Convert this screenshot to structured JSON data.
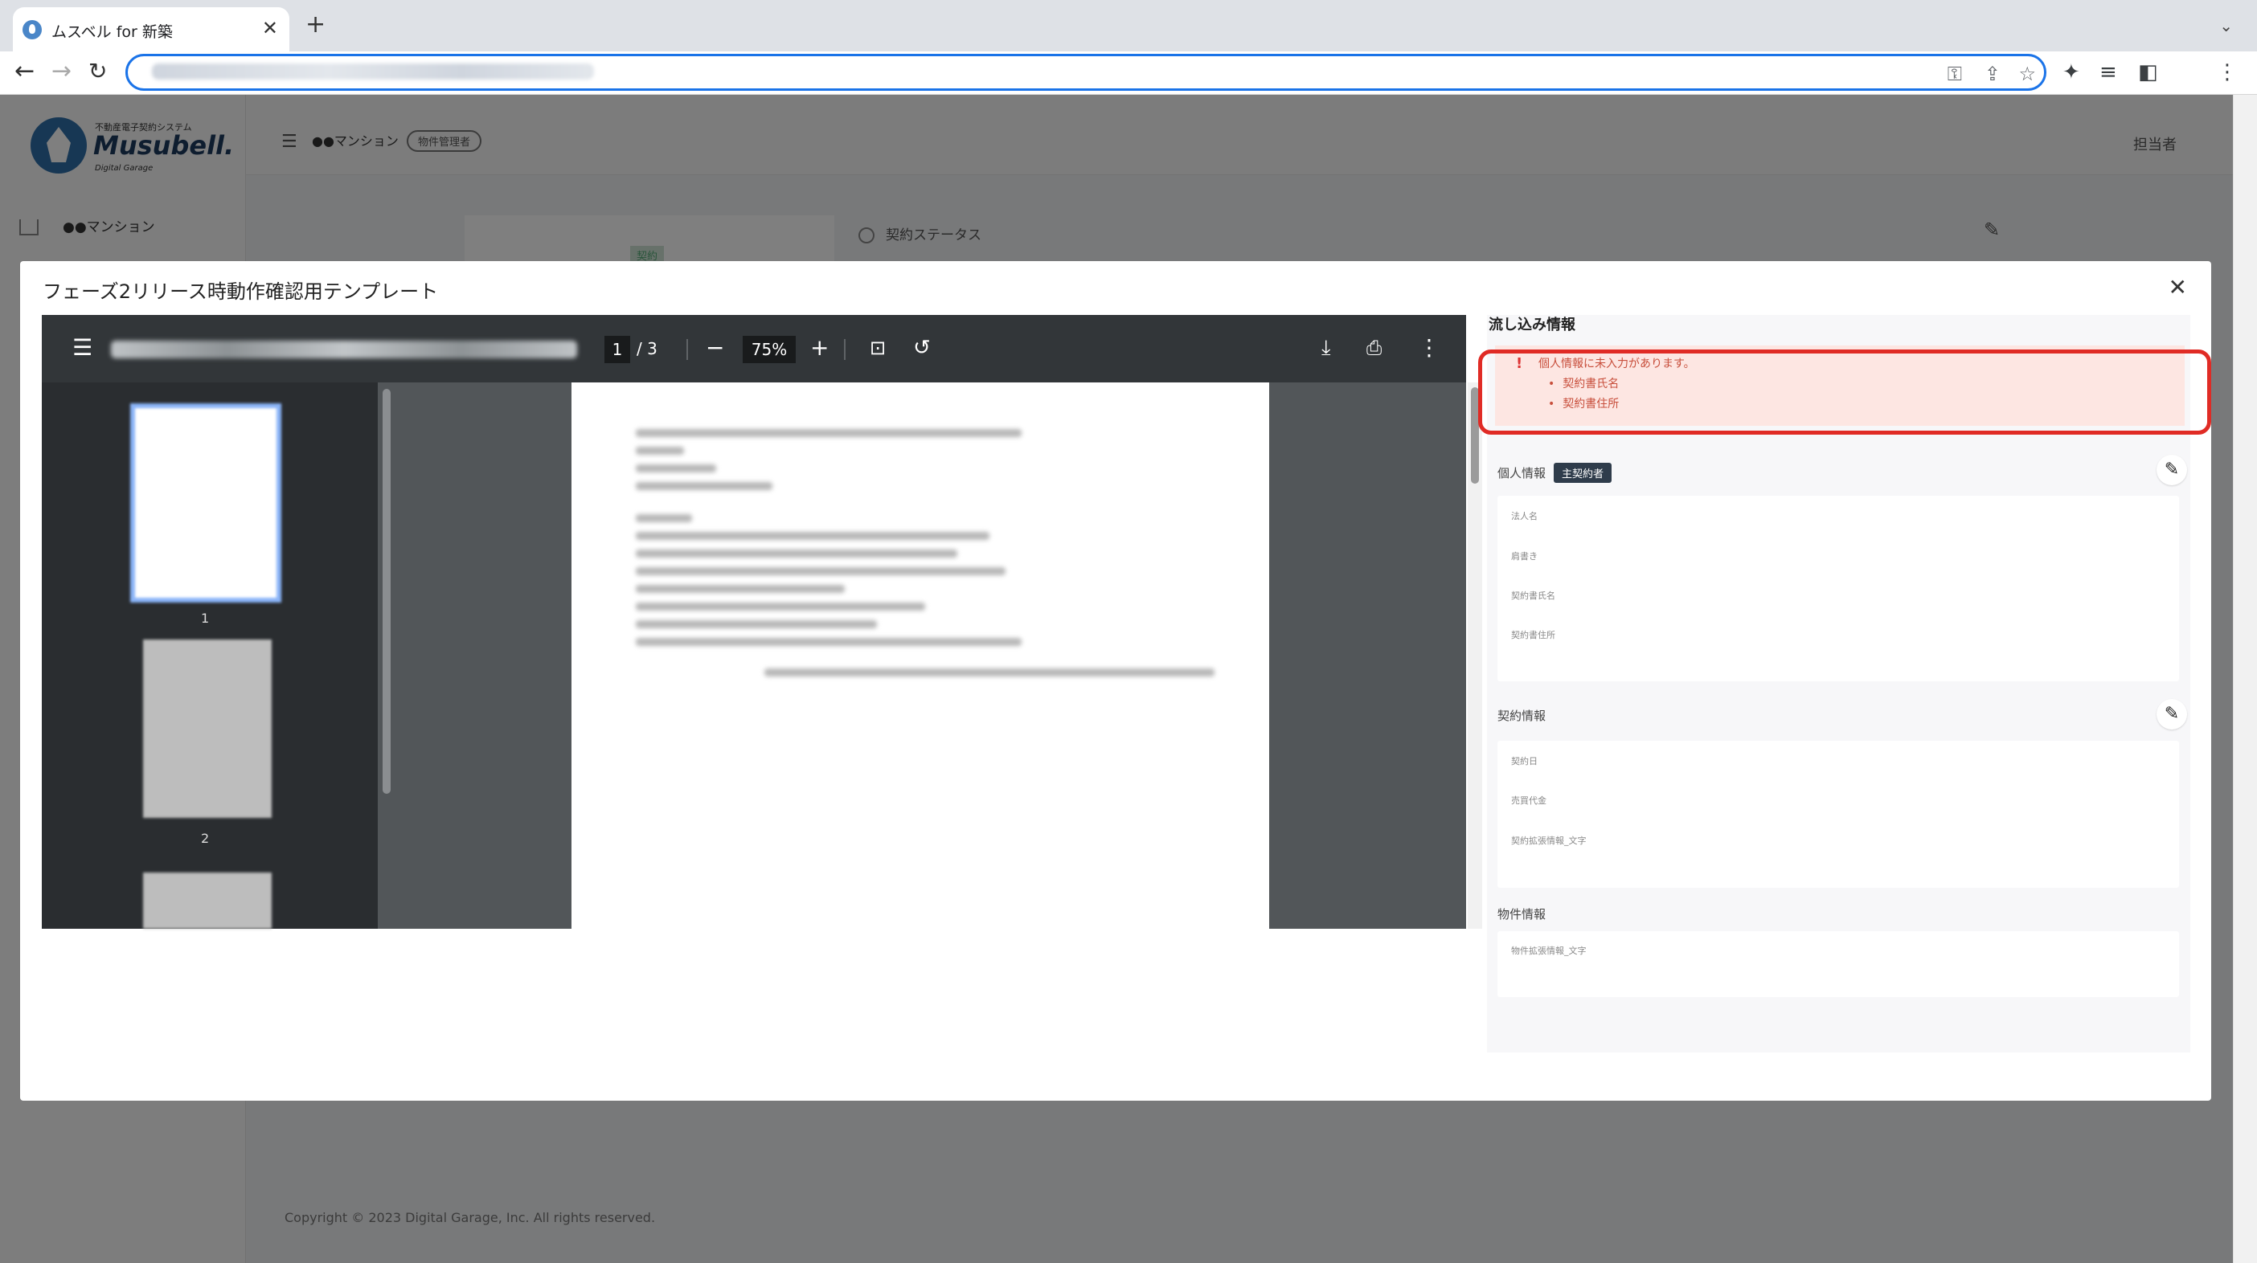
{
  "browser": {
    "tab_title": "ムスベル for 新築",
    "new_tab": "+",
    "tab_close": "✕",
    "back": "←",
    "forward": "→",
    "reload": "↻"
  },
  "app": {
    "logo_sub": "不動産電子契約システム",
    "logo_name": "Musubell.",
    "logo_dg": "Digital Garage",
    "sidebar_property": "●●マンション",
    "header_property": "●●マンション",
    "role_badge": "物件管理者",
    "user": "担当者",
    "contract_tag": "契約",
    "contract_status": "契約ステータス",
    "footer": "Copyright © 2023 Digital Garage, Inc. All rights reserved."
  },
  "modal": {
    "title": "フェーズ2リリース時動作確認用テンプレート",
    "close": "✕",
    "pdf": {
      "page_current": "1",
      "page_total": "/ 3",
      "zoom": "75%",
      "thumb_labels": [
        "1",
        "2"
      ]
    },
    "panel": {
      "title": "流し込み情報",
      "error": {
        "icon": "!",
        "message": "個人情報に未入力があります。",
        "items": [
          "契約書氏名",
          "契約書住所"
        ]
      },
      "personal": {
        "title": "個人情報",
        "badge": "主契約者",
        "fields": [
          "法人名",
          "肩書き",
          "契約書氏名",
          "契約書住所"
        ]
      },
      "contract": {
        "title": "契約情報",
        "fields": [
          "契約日",
          "売買代金",
          "契約拡張情報_文字"
        ]
      },
      "property": {
        "title": "物件情報",
        "fields": [
          "物件拡張情報_文字"
        ]
      }
    }
  },
  "colors": {
    "accent": "#1a73e8",
    "error_border": "#e02b25",
    "error_bg": "#fde6e2",
    "badge_bg": "#2f3c4b"
  }
}
